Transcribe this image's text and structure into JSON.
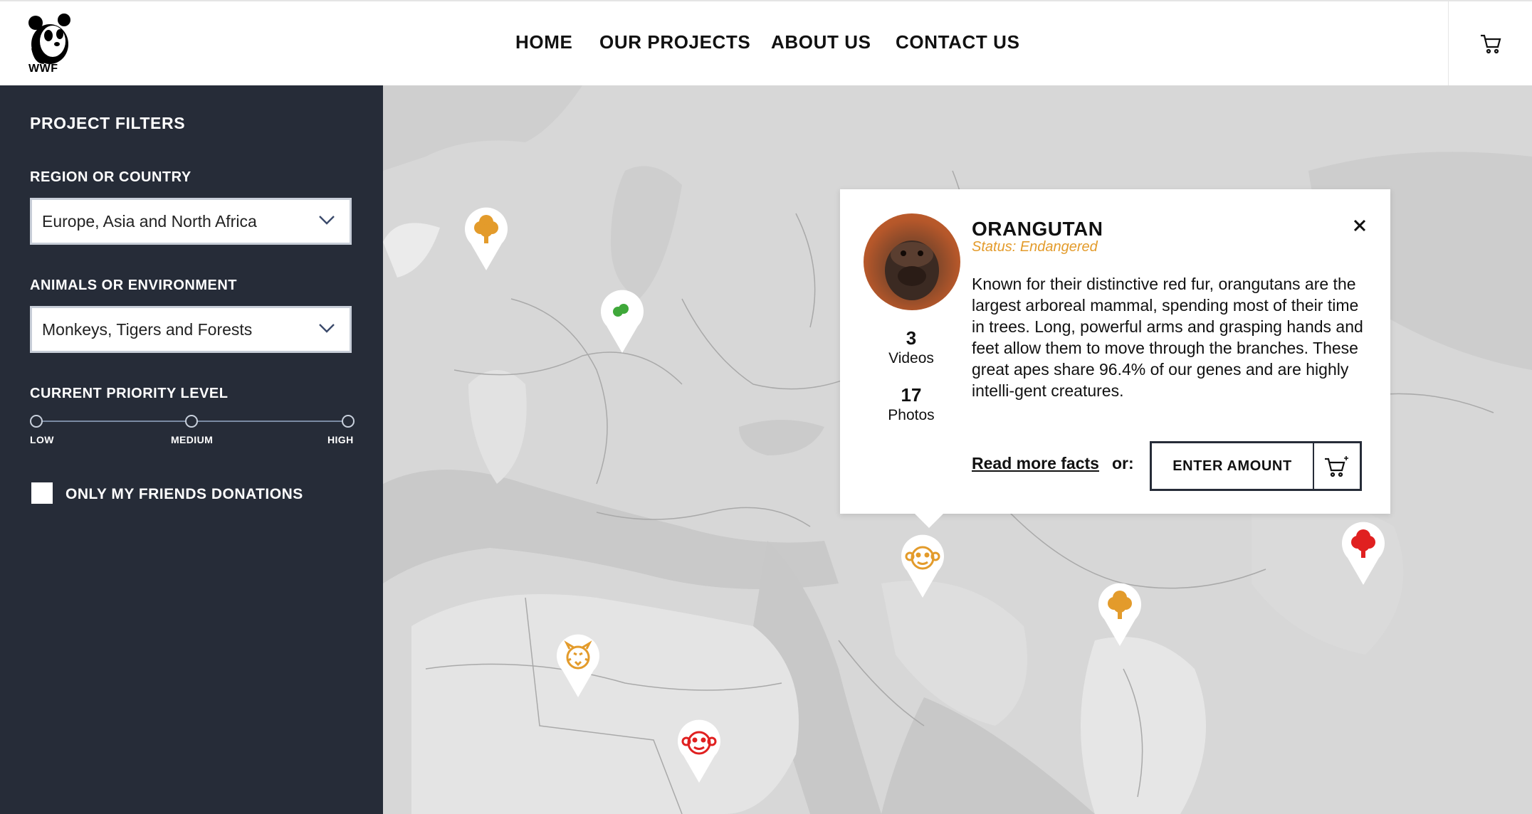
{
  "header": {
    "logo_text": "WWF",
    "nav": [
      "HOME",
      "OUR PROJECTS",
      "ABOUT US",
      "CONTACT US"
    ],
    "cart_icon": "cart-icon"
  },
  "sidebar": {
    "title": "PROJECT FILTERS",
    "region_label": "REGION OR COUNTRY",
    "region_value": "Europe, Asia and North Africa",
    "animals_label": "ANIMALS OR ENVIRONMENT",
    "animals_value": "Monkeys, Tigers and Forests",
    "priority_label": "CURRENT PRIORITY LEVEL",
    "priority_levels": [
      "LOW",
      "MEDIUM",
      "HIGH"
    ],
    "friends_label": "ONLY MY FRIENDS DONATIONS",
    "friends_checked": false
  },
  "popup": {
    "title": "ORANGUTAN",
    "status": "Status: Endangered",
    "description": "Known for their distinctive red fur, orangutans are the largest arboreal mammal, spending most of their time in trees. Long, powerful arms and grasping hands and feet allow them to move through the branches. These great apes share 96.4% of our genes and are highly intelli-gent creatures.",
    "videos_count": "3",
    "videos_label": "Videos",
    "photos_count": "17",
    "photos_label": "Photos",
    "read_more": "Read more facts",
    "or": "or:",
    "enter_amount": "ENTER AMOUNT"
  },
  "map_pins": [
    {
      "icon": "tree-icon",
      "color": "#e39b2b"
    },
    {
      "icon": "tree-icon",
      "color": "#3fa83a"
    },
    {
      "icon": "monkey-icon",
      "color": "#e39b2b"
    },
    {
      "icon": "tree-icon",
      "color": "#e39b2b"
    },
    {
      "icon": "tree-icon",
      "color": "#e02020"
    },
    {
      "icon": "tiger-icon",
      "color": "#e39b2b"
    },
    {
      "icon": "monkey-icon",
      "color": "#e02020"
    }
  ],
  "colors": {
    "sidebar_bg": "#262c38",
    "accent_orange": "#e39b2b",
    "accent_red": "#e02020",
    "accent_green": "#3fa83a"
  }
}
